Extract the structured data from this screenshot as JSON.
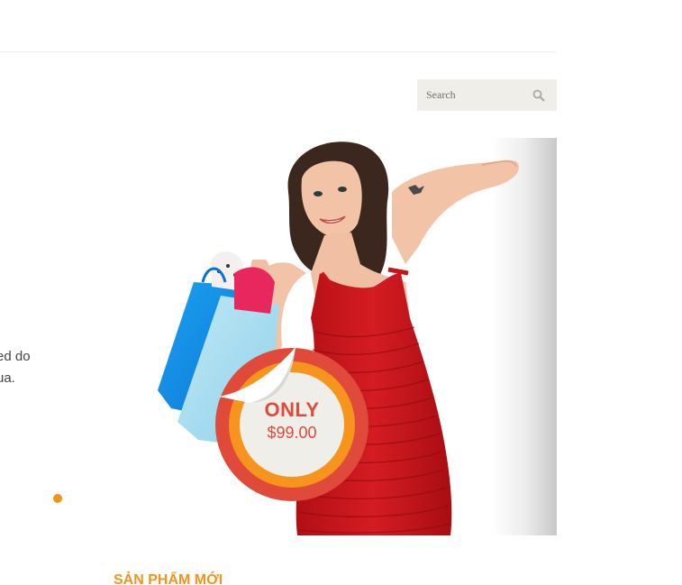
{
  "search": {
    "placeholder": "Search",
    "icon": "search-icon"
  },
  "slider": {
    "text_lines": [
      "ed do",
      "ua."
    ],
    "next_icon": "chevron-right-icon",
    "active_dot_color": "#f39418"
  },
  "promo": {
    "only_label": "ONLY",
    "price": "$99.00",
    "ring_outer_color": "#e04a3a",
    "ring_inner_color": "#f7941d"
  },
  "section": {
    "title": "SẢN PHẨM MỚI"
  },
  "colors": {
    "accent": "#f39418",
    "search_bg": "#efeee9",
    "dress_red": "#c8151b"
  }
}
